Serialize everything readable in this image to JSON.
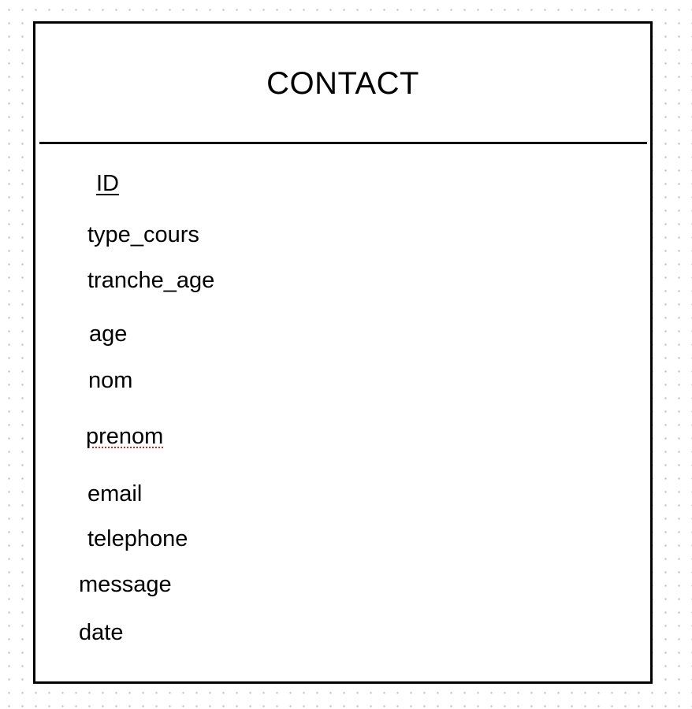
{
  "entity": {
    "title": "CONTACT",
    "attributes": [
      {
        "name": "ID",
        "primary_key": true
      },
      {
        "name": "type_cours"
      },
      {
        "name": "tranche_age"
      },
      {
        "name": "age"
      },
      {
        "name": "nom"
      },
      {
        "name": "prenom"
      },
      {
        "name": "email"
      },
      {
        "name": "telephone"
      },
      {
        "name": "message"
      },
      {
        "name": "date"
      }
    ]
  },
  "colors": {
    "border": "#000000",
    "background": "#ffffff",
    "grid_dots": "#c9c9c9",
    "spellcheck_underline": "#dd2222"
  }
}
